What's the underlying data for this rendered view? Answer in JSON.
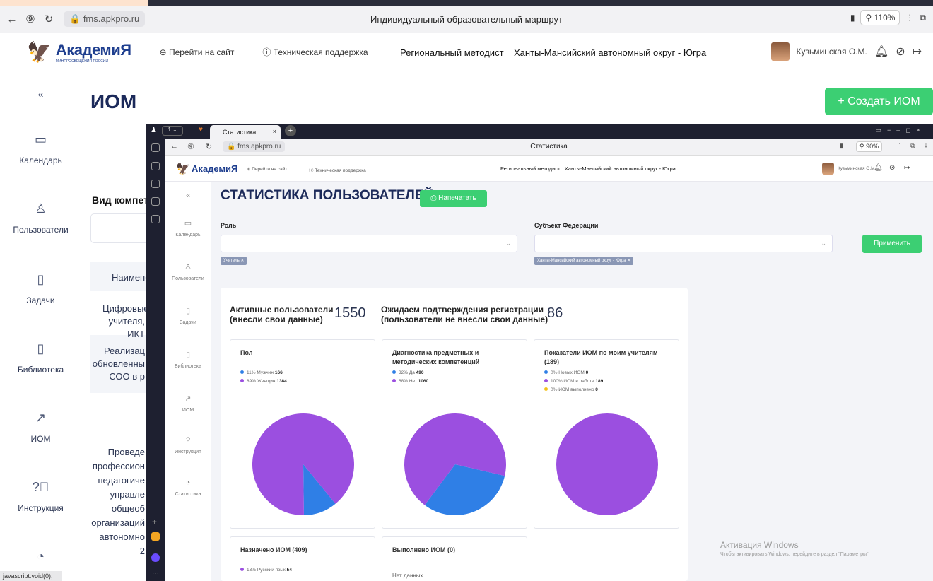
{
  "outer": {
    "url": "fms.apkpro.ru",
    "window_title": "Индивидуальный образовательный маршрут",
    "zoom": "110%",
    "logo_text": "АкадемиЯ",
    "logo_sub": "МИНПРОСВЕЩЕНИЯ РОССИИ",
    "link_site": "Перейти на сайт",
    "link_support": "Техническая поддержка",
    "role": "Региональный методист",
    "region": "Ханты-Мансийский автономный округ - Югра",
    "user": "Кузьминская О.М.",
    "sidebar": [
      {
        "label": "Календарь",
        "icon": "calendar-icon"
      },
      {
        "label": "Пользователи",
        "icon": "users-icon"
      },
      {
        "label": "Задачи",
        "icon": "clipboard-icon"
      },
      {
        "label": "Библиотека",
        "icon": "book-icon"
      },
      {
        "label": "ИОМ",
        "icon": "trend-icon"
      },
      {
        "label": "Инструкция",
        "icon": "help-icon"
      }
    ],
    "page_title": "ИОМ",
    "create_button": "+ Создать ИОМ",
    "frag_vid": "Вид компет",
    "frag_naim": "Наимено",
    "frag_rows": [
      [
        "Цифровые",
        "учителя, ИКТ"
      ],
      [
        "Реализац",
        "обновленны",
        "СОО в р"
      ],
      [
        "Проведе",
        "профессион",
        "педагогиче",
        "управле",
        "общеоб",
        "организаций",
        "автономно",
        "2"
      ]
    ],
    "status_url": "javascript:void(0);"
  },
  "inner": {
    "tab_title": "Статистика",
    "url": "fms.apkpro.ru",
    "window_title": "Статистика",
    "zoom": "90%",
    "logo_text": "АкадемиЯ",
    "link_site": "Перейти на сайт",
    "link_support": "Техническая поддержка",
    "role": "Региональный методист",
    "region": "Ханты-Мансийский автономный округ - Югра",
    "user": "Кузьминская О.М.",
    "sidebar": [
      {
        "label": "Календарь"
      },
      {
        "label": "Пользователи"
      },
      {
        "label": "Задачи"
      },
      {
        "label": "Библиотека"
      },
      {
        "label": "ИОМ"
      },
      {
        "label": "Инструкция"
      },
      {
        "label": "Статистика"
      }
    ],
    "title": "СТАТИСТИКА ПОЛЬЗОВАТЕЛЕЙ",
    "print_button": "Напечатать",
    "filter_role_label": "Роль",
    "filter_role_chip": "Учитель",
    "filter_region_label": "Субъект Федерации",
    "filter_region_chip": "Ханты-Мансийский автономный округ - Югра",
    "apply_button": "Применить",
    "active_label_1": "Активные пользователи",
    "active_label_2": "(внесли свои данные)",
    "active_value": "1550",
    "pending_label_1": "Ожидаем подтверждения регистрации",
    "pending_label_2": "(пользователи не внесли свои данные)",
    "pending_value": "86"
  },
  "chart_data": [
    {
      "type": "pie",
      "title": "Пол",
      "slices": [
        {
          "label": "11% Мужчин",
          "value": 166,
          "color": "#2f7fe6"
        },
        {
          "label": "89% Женщин",
          "value": 1384,
          "color": "#9b4fe0"
        }
      ]
    },
    {
      "type": "pie",
      "title": "Диагностика предметных и методических компетенций",
      "slices": [
        {
          "label": "32% Да",
          "value": 490,
          "color": "#2f7fe6"
        },
        {
          "label": "68% Нет",
          "value": 1060,
          "color": "#9b4fe0"
        }
      ]
    },
    {
      "type": "pie",
      "title": "Показатели ИОМ по моим учителям (189)",
      "slices": [
        {
          "label": "0% Новых ИОМ",
          "value": 0,
          "color": "#2f7fe6"
        },
        {
          "label": "100% ИОМ в работе",
          "value": 189,
          "color": "#9b4fe0"
        },
        {
          "label": "0% ИОМ выполнено",
          "value": 0,
          "color": "#f2c21b"
        }
      ]
    },
    {
      "type": "pie",
      "title": "Назначено ИОМ (409)",
      "slices": [
        {
          "label": "13% Русский язык",
          "value": 54,
          "color": "#9b4fe0"
        }
      ]
    },
    {
      "type": "pie",
      "title": "Выполнено ИОМ (0)",
      "slices": [],
      "empty_text": "Нет данных"
    }
  ],
  "windows_activation": {
    "line1": "Активация Windows",
    "line2": "Чтобы активировать Windows, перейдите в раздел \"Параметры\"."
  }
}
